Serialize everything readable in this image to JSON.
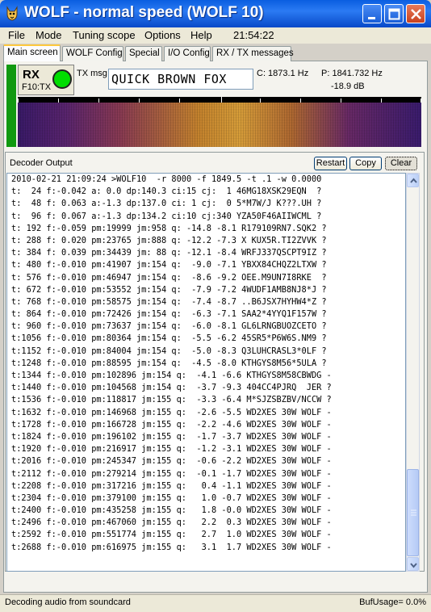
{
  "window": {
    "title": "WOLF - normal speed (WOLF 10)"
  },
  "menu": {
    "items": [
      "File",
      "Mode",
      "Tuning scope",
      "Options",
      "Help"
    ],
    "clock": "21:54:22"
  },
  "tabs": [
    "Main screen",
    "WOLF Config",
    "Special",
    "I/O Config",
    "RX / TX messages"
  ],
  "status_panel": {
    "mode": "RX",
    "key_hint": "F10:TX",
    "tx_msg_label": "TX msg",
    "tx_msg_value": "QUICK BROWN FOX",
    "c_freq": "C: 1873.1 Hz",
    "p_freq": "P: 1841.732 Hz",
    "level": "-18.9 dB"
  },
  "decoder": {
    "label": "Decoder Output",
    "buttons": {
      "restart": "Restart",
      "copy": "Copy",
      "clear": "Clear"
    },
    "lines": [
      "2010-02-21 21:09:24 >WOLF10  -r 8000 -f 1849.5 -t .1 -w 0.0000",
      "t:  24 f:-0.042 a: 0.0 dp:140.3 ci:15 cj:  1 46MG18XSK29EQN  ?",
      "t:  48 f: 0.063 a:-1.3 dp:137.0 ci: 1 cj:  0 5*M7W/J K???.UH ?",
      "t:  96 f: 0.067 a:-1.3 dp:134.2 ci:10 cj:340 YZA50F46AIIWCML ?",
      "t: 192 f:-0.059 pm:19999 jm:958 q: -14.8 -8.1 R179109RN7.SQK2 ?",
      "t: 288 f: 0.020 pm:23765 jm:888 q: -12.2 -7.3 X KUX5R.TI2ZVVK ?",
      "t: 384 f: 0.039 pm:34439 jm: 88 q: -12.1 -8.4 WRFJ337QSCPT9IZ ?",
      "t: 480 f:-0.010 pm:41907 jm:154 q:  -9.0 -7.1 YBXX84CHQZ2LTXW ?",
      "t: 576 f:-0.010 pm:46947 jm:154 q:  -8.6 -9.2 OEE.M9UN7I8RKE  ?",
      "t: 672 f:-0.010 pm:53552 jm:154 q:  -7.9 -7.2 4WUDF1AMB8NJ8*J ?",
      "t: 768 f:-0.010 pm:58575 jm:154 q:  -7.4 -8.7 ..B6JSX7HYHW4*Z ?",
      "t: 864 f:-0.010 pm:72426 jm:154 q:  -6.3 -7.1 SAA2*4YYQ1F157W ?",
      "t: 960 f:-0.010 pm:73637 jm:154 q:  -6.0 -8.1 GL6LRNGBUOZCETO ?",
      "t:1056 f:-0.010 pm:80364 jm:154 q:  -5.5 -6.2 45SR5*P6W6S.NM9 ?",
      "t:1152 f:-0.010 pm:84004 jm:154 q:  -5.0 -8.3 Q3LUHCRASL3*0LF ?",
      "t:1248 f:-0.010 pm:88595 jm:154 q:  -4.5 -8.0 KTHGYS8M56*5ULA ?",
      "t:1344 f:-0.010 pm:102896 jm:154 q:  -4.1 -6.6 KTHGYS8M58CBWDG -",
      "t:1440 f:-0.010 pm:104568 jm:154 q:  -3.7 -9.3 404CC4PJRQ  JER ?",
      "t:1536 f:-0.010 pm:118817 jm:155 q:  -3.3 -6.4 M*SJZSBZBV/NCCW ?",
      "t:1632 f:-0.010 pm:146968 jm:155 q:  -2.6 -5.5 WD2XES 30W WOLF -",
      "t:1728 f:-0.010 pm:166728 jm:155 q:  -2.2 -4.6 WD2XES 30W WOLF -",
      "t:1824 f:-0.010 pm:196102 jm:155 q:  -1.7 -3.7 WD2XES 30W WOLF -",
      "t:1920 f:-0.010 pm:216917 jm:155 q:  -1.2 -3.1 WD2XES 30W WOLF -",
      "t:2016 f:-0.010 pm:245347 jm:155 q:  -0.6 -2.2 WD2XES 30W WOLF -",
      "t:2112 f:-0.010 pm:279214 jm:155 q:  -0.1 -1.7 WD2XES 30W WOLF -",
      "t:2208 f:-0.010 pm:317216 jm:155 q:   0.4 -1.1 WD2XES 30W WOLF -",
      "t:2304 f:-0.010 pm:379100 jm:155 q:   1.0 -0.7 WD2XES 30W WOLF -",
      "t:2400 f:-0.010 pm:435258 jm:155 q:   1.8 -0.0 WD2XES 30W WOLF -",
      "t:2496 f:-0.010 pm:467060 jm:155 q:   2.2  0.3 WD2XES 30W WOLF -",
      "t:2592 f:-0.010 pm:551774 jm:155 q:   2.7  1.0 WD2XES 30W WOLF -",
      "t:2688 f:-0.010 pm:616975 jm:155 q:   3.1  1.7 WD2XES 30W WOLF -"
    ]
  },
  "statusbar": {
    "left": "Decoding audio from soundcard",
    "right": "BufUsage= 0.0%"
  },
  "colors": {
    "title_blue": "#0a5ee0",
    "rx_led": "#00dd00",
    "rx_strip": "#119911"
  },
  "icons": [
    "wolf-app-icon",
    "minimize-icon",
    "maximize-icon",
    "close-icon",
    "scroll-up-icon",
    "scroll-down-icon"
  ]
}
